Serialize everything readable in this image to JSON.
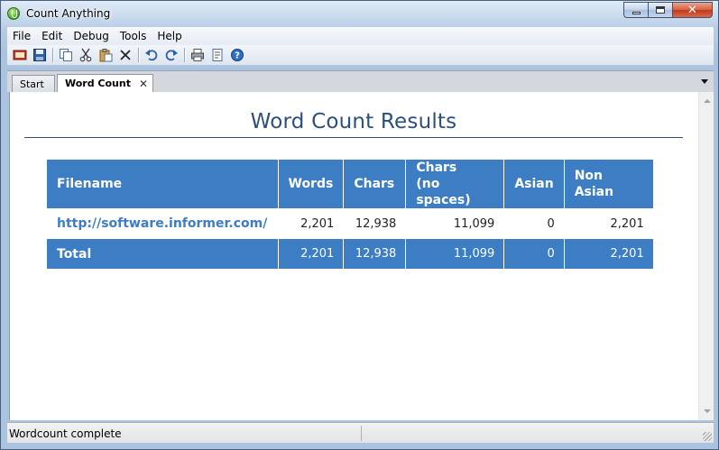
{
  "window": {
    "title": "Count Anything"
  },
  "menubar": {
    "items": [
      "File",
      "Edit",
      "Debug",
      "Tools",
      "Help"
    ]
  },
  "toolbar": {
    "icons": [
      "open-icon",
      "save-icon",
      "copy-icon",
      "cut-icon",
      "paste-icon",
      "delete-icon",
      "undo-icon",
      "redo-icon",
      "print-icon",
      "properties-icon",
      "help-icon"
    ]
  },
  "tabs": [
    {
      "label": "Start",
      "active": false
    },
    {
      "label": "Word Count",
      "active": true
    }
  ],
  "results": {
    "title": "Word Count Results",
    "headers": {
      "filename": "Filename",
      "words": "Words",
      "chars": "Chars",
      "chars_no_spaces_line1": "Chars",
      "chars_no_spaces_line2": "(no spaces)",
      "asian": "Asian",
      "non_asian": "Non Asian"
    },
    "rows": [
      {
        "filename": "http://software.informer.com/",
        "words": "2,201",
        "chars": "12,938",
        "chars_no_spaces": "11,099",
        "asian": "0",
        "non_asian": "2,201"
      }
    ],
    "total": {
      "label": "Total",
      "words": "2,201",
      "chars": "12,938",
      "chars_no_spaces": "11,099",
      "asian": "0",
      "non_asian": "2,201"
    }
  },
  "statusbar": {
    "text": "Wordcount complete"
  },
  "colors": {
    "accent": "#3c7dc4",
    "title": "#2c4f7c"
  }
}
